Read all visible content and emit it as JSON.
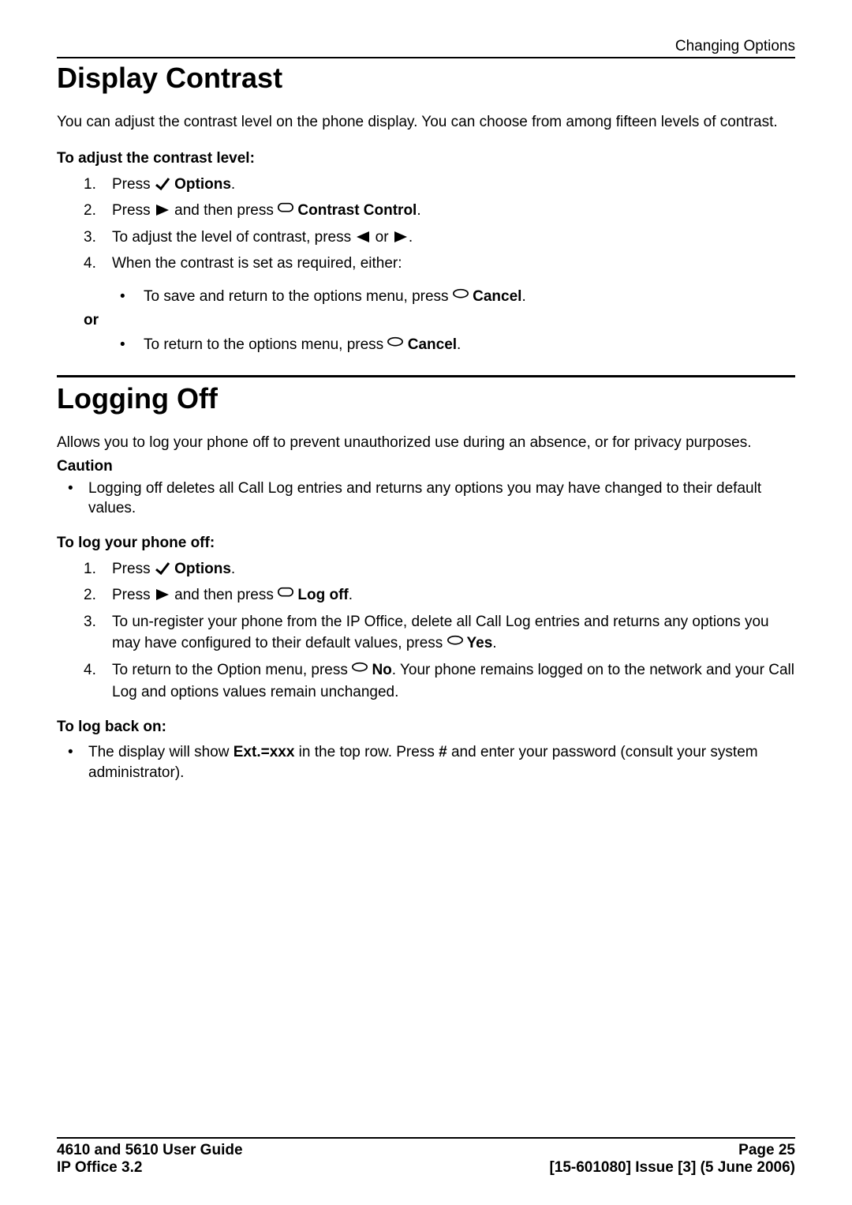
{
  "header": {
    "running": "Changing Options"
  },
  "section1": {
    "title": "Display Contrast",
    "intro": "You can adjust the contrast level on the phone display. You can choose from among fifteen levels of contrast.",
    "subhead": "To adjust the contrast level:",
    "step1_a": "Press",
    "options_label": " Options",
    "step2_a": "Press ",
    "step2_b": " and then press ",
    "contrast_ctrl": " Contrast Control",
    "step3_a": "To adjust the level of contrast, press ",
    "step3_b": " or ",
    "step4": "When the contrast is set as required, either:",
    "sub1_a": "To save and return to the options menu, press ",
    "cancel_label": " Cancel",
    "or": "or",
    "sub2_a": "To return to the options menu, press ",
    "period": "."
  },
  "section2": {
    "title": "Logging Off",
    "intro": "Allows you to log your phone off to prevent unauthorized use during an absence, or for privacy purposes.",
    "caution_label": "Caution",
    "caution_text": "Logging off deletes all Call Log entries and returns any options you may have changed to their default values.",
    "subhead1": "To log your phone off:",
    "step1_a": "Press",
    "options_label": " Options",
    "step2_a": "Press ",
    "step2_b": " and then press ",
    "logoff_label": " Log off",
    "step3_a": "To un-register your phone from the IP Office, delete all Call Log entries and returns any options you may have configured to their default values, press ",
    "yes_label": " Yes",
    "step4_a": "To return to the Option menu, press ",
    "no_label": " No",
    "step4_b": ". Your phone remains logged on to the network and your Call Log and options values remain unchanged.",
    "subhead2": "To log back on:",
    "back_a": "The display will show ",
    "ext_label": "Ext.=xxx",
    "back_b": " in the top row. Press ",
    "hash_label": "#",
    "back_c": " and enter your password (consult your system administrator).",
    "period": "."
  },
  "footer": {
    "left1": "4610 and 5610 User Guide",
    "left2": "IP Office 3.2",
    "right1": "Page 25",
    "right2": "[15-601080] Issue [3] (5 June 2006)"
  }
}
